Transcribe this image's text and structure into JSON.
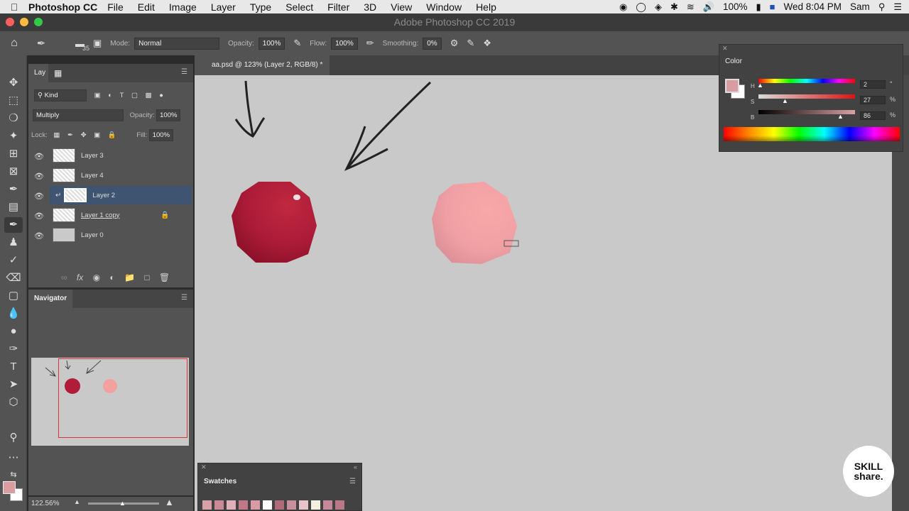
{
  "menubar": {
    "app_name": "Photoshop CC",
    "items": [
      "File",
      "Edit",
      "Image",
      "Layer",
      "Type",
      "Select",
      "Filter",
      "3D",
      "View",
      "Window",
      "Help"
    ],
    "battery": "100%",
    "clock": "Wed 8:04 PM",
    "user": "Sam"
  },
  "window": {
    "title": "Adobe Photoshop CC 2019"
  },
  "options": {
    "brush_size": "35",
    "mode_label": "Mode:",
    "mode_value": "Normal",
    "opacity_label": "Opacity:",
    "opacity_value": "100%",
    "flow_label": "Flow:",
    "flow_value": "100%",
    "smoothing_label": "Smoothing:",
    "smoothing_value": "0%"
  },
  "layers_panel": {
    "tab_label": "Lay",
    "kind_label": "Kind",
    "blend_mode": "Multiply",
    "opacity_label": "Opacity:",
    "opacity_value": "100%",
    "lock_label": "Lock:",
    "fill_label": "Fill:",
    "fill_value": "100%",
    "layers": [
      {
        "name": "Layer 3"
      },
      {
        "name": "Layer 4"
      },
      {
        "name": "Layer 2"
      },
      {
        "name": "Layer 1 copy"
      },
      {
        "name": "Layer 0"
      }
    ]
  },
  "navigator": {
    "tab_label": "Navigator",
    "zoom": "122.56%"
  },
  "document": {
    "tab_title": "aa.psd @ 123% (Layer 2, RGB/8) *"
  },
  "color_panel": {
    "title": "Color",
    "h_label": "H",
    "h_value": "2",
    "h_unit": "°",
    "s_label": "S",
    "s_value": "27",
    "s_unit": "%",
    "b_label": "B",
    "b_value": "86",
    "b_unit": "%",
    "foreground_color": "#d99ca0",
    "h_level": 0.01,
    "s_level": 0.27,
    "b_level": 0.86
  },
  "swatches_panel": {
    "title": "Swatches",
    "colors": [
      "#d9a0a8",
      "#c98a96",
      "#e0b0b8",
      "#c07888",
      "#d89aa6",
      "#ffffff",
      "#b06a7a",
      "#c8909c",
      "#e6c4c8",
      "#f4f0e0",
      "#c48898",
      "#b87888"
    ]
  },
  "logo": {
    "line1": "SKILL",
    "line2": "share."
  },
  "canvas": {
    "dark_ball_color": "#b01c3a",
    "light_ball_color": "#f2a0a0"
  }
}
